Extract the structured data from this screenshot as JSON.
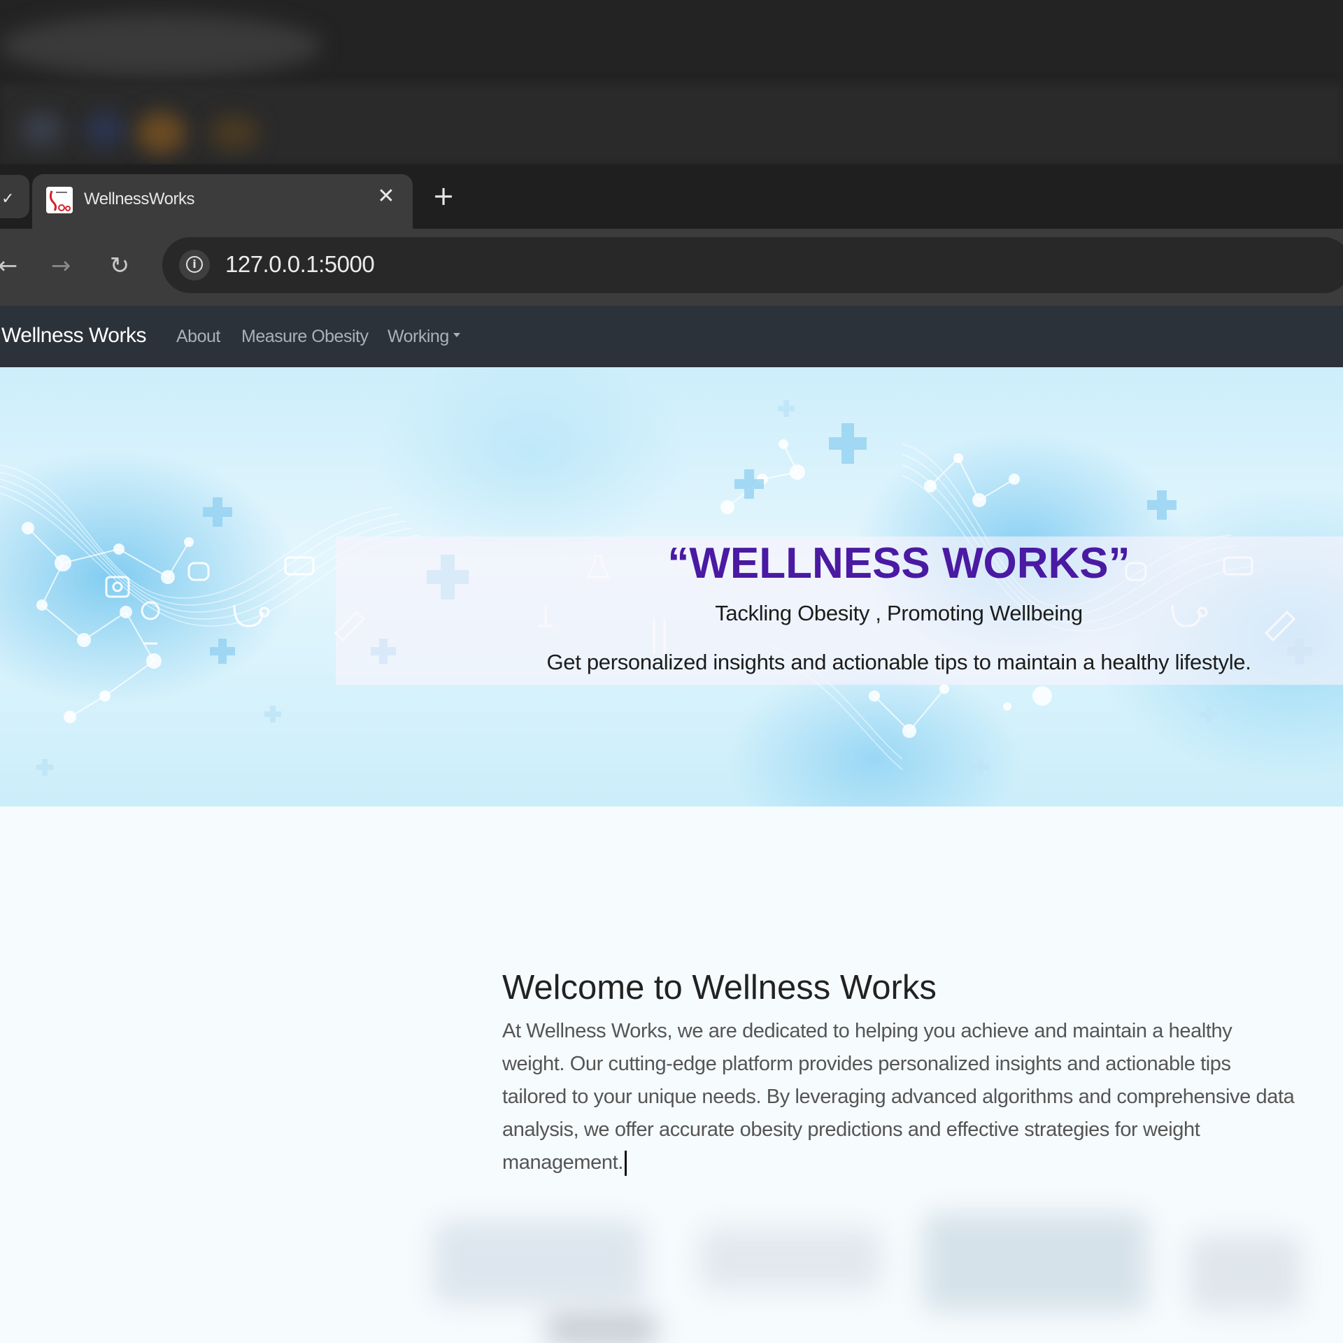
{
  "browser": {
    "tab_title": "WellnessWorks",
    "close_symbol": "✕",
    "new_tab_symbol": "+",
    "address": "127.0.0.1:5000"
  },
  "icons": {
    "back": "back-arrow-icon",
    "forward": "forward-arrow-icon",
    "reload": "reload-icon",
    "site_info": "info-icon",
    "tab_favicon": "site-favicon-icon"
  },
  "navbar": {
    "brand": "Wellness Works",
    "links": [
      "About",
      "Measure Obesity",
      "Working"
    ]
  },
  "hero": {
    "title": "“WELLNESS WORKS”",
    "subtitle": "Tackling Obesity , Promoting Wellbeing",
    "description": "Get personalized insights and actionable tips to maintain a healthy lifestyle."
  },
  "welcome": {
    "heading": "Welcome to Wellness Works",
    "paragraph": "At Wellness Works, we are dedicated to helping you achieve and maintain a healthy weight. Our cutting-edge platform provides personalized insights and actionable tips tailored to your unique needs. By leveraging advanced algorithms and comprehensive data analysis, we offer accurate obesity predictions and effective strategies for weight management."
  },
  "colors": {
    "accent_title": "#4a1aa3",
    "navbar_bg": "#2c323a",
    "hero_blue": "#5fbdec"
  }
}
